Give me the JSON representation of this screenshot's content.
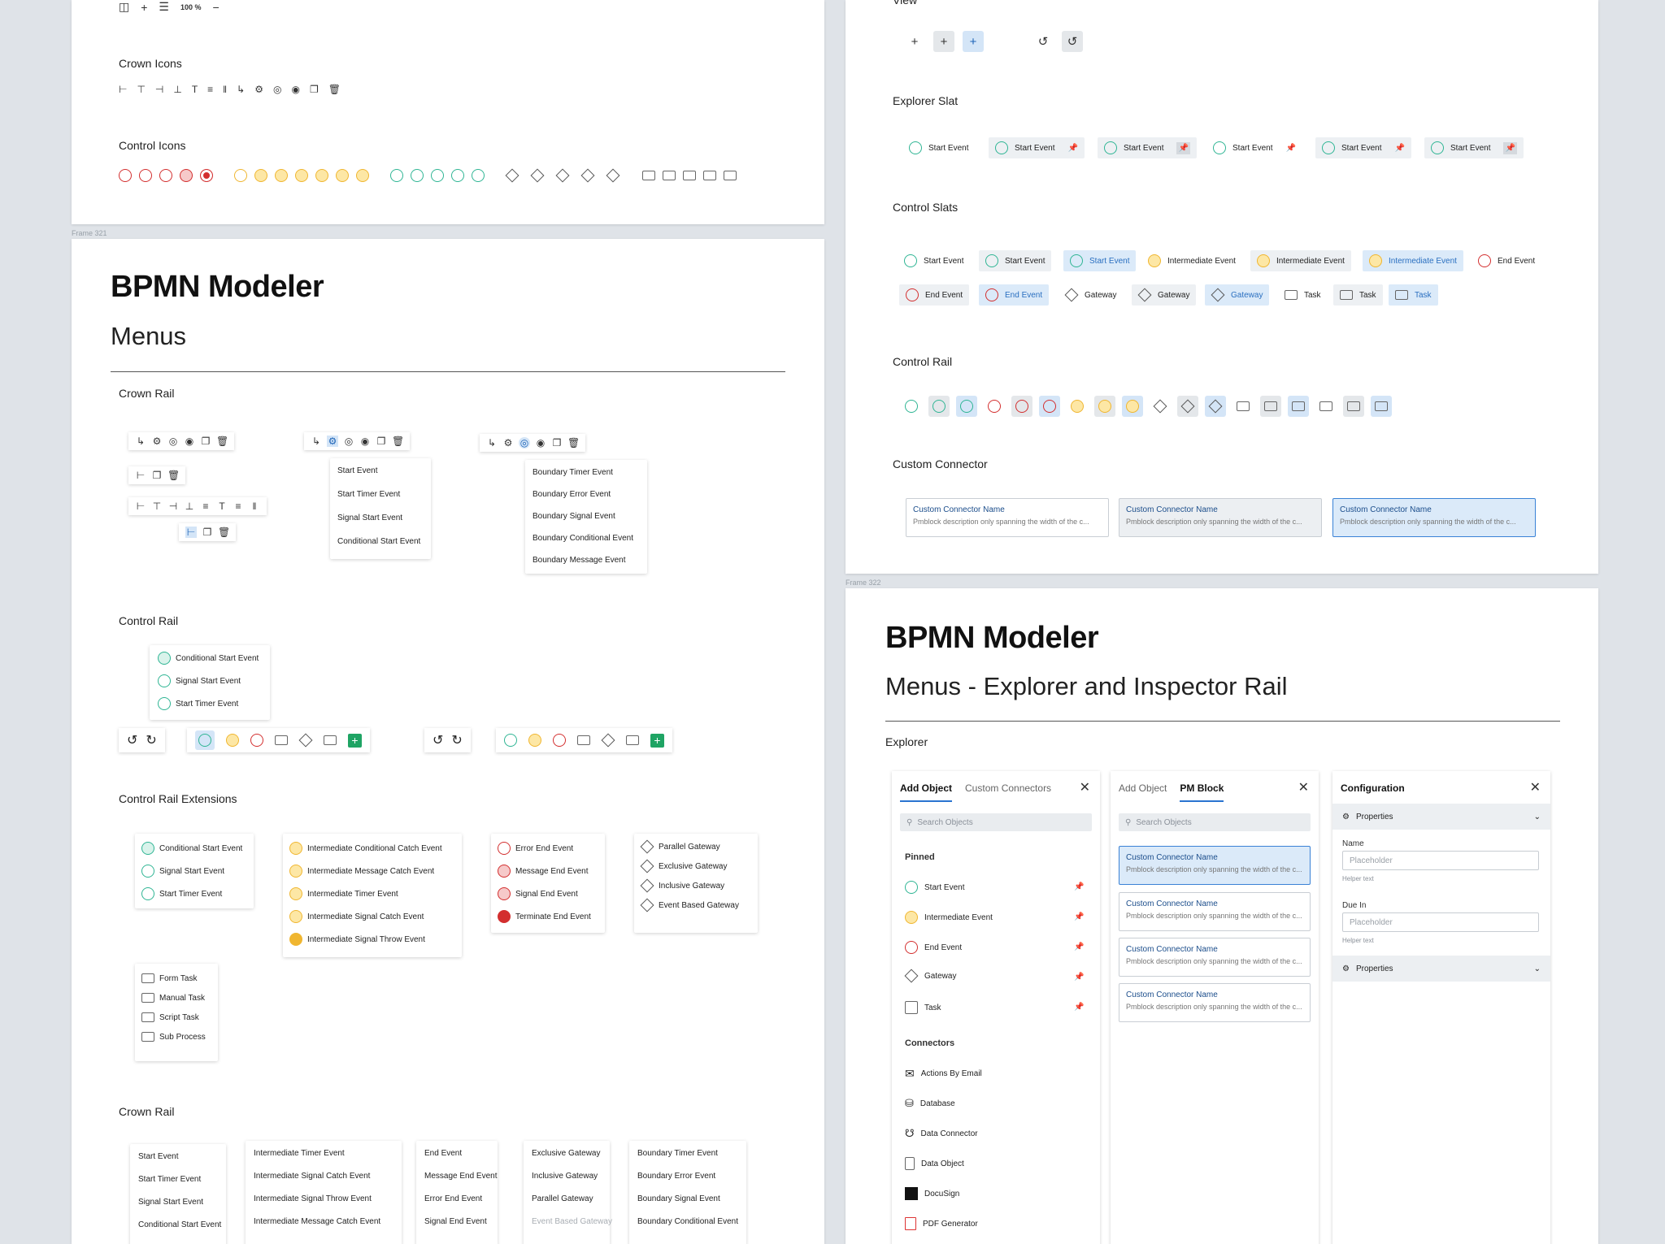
{
  "frames": {
    "frame321": "Frame 321",
    "frame322": "Frame 322"
  },
  "topleft": {
    "zoom": "100 %",
    "crown_icons_heading": "Crown Icons",
    "control_icons_heading": "Control Icons"
  },
  "menus": {
    "title": "BPMN Modeler",
    "subtitle": "Menus",
    "crown_rail_heading": "Crown Rail",
    "start_events": [
      "Start Event",
      "Start Timer Event",
      "Signal Start Event",
      "Conditional Start Event"
    ],
    "boundary_events": [
      "Boundary Timer Event",
      "Boundary Error Event",
      "Boundary Signal Event",
      "Boundary Conditional Event",
      "Boundary Message Event"
    ],
    "control_rail_heading": "Control Rail",
    "control_rail_popup": [
      "Conditional Start Event",
      "Signal Start Event",
      "Start Timer Event"
    ],
    "extensions_heading": "Control Rail Extensions",
    "ext_start": [
      "Conditional Start Event",
      "Signal Start Event",
      "Start Timer Event"
    ],
    "ext_intermediate": [
      "Intermediate Conditional Catch Event",
      "Intermediate Message Catch Event",
      "Intermediate Timer Event",
      "Intermediate Signal Catch Event",
      "Intermediate Signal Throw Event"
    ],
    "ext_end": [
      "Error End Event",
      "Message End Event",
      "Signal End Event",
      "Terminate End Event"
    ],
    "ext_gateway": [
      "Parallel Gateway",
      "Exclusive Gateway",
      "Inclusive Gateway",
      "Event Based Gateway"
    ],
    "ext_task": [
      "Form Task",
      "Manual Task",
      "Script Task",
      "Sub Process"
    ],
    "crown_rail2_heading": "Crown Rail",
    "cr_start": [
      "Start Event",
      "Start Timer Event",
      "Signal Start Event",
      "Conditional Start Event"
    ],
    "cr_intermediate": [
      "Intermediate Timer Event",
      "Intermediate Signal Catch Event",
      "Intermediate Signal Throw Event",
      "Intermediate Message Catch Event"
    ],
    "cr_end": [
      "End Event",
      "Message End Event",
      "Error End Event",
      "Signal End Event"
    ],
    "cr_gateway": [
      "Exclusive Gateway",
      "Inclusive Gateway",
      "Parallel Gateway",
      "Event Based Gateway"
    ],
    "cr_boundary": [
      "Boundary Timer Event",
      "Boundary Error Event",
      "Boundary Signal Event",
      "Boundary Conditional Event"
    ]
  },
  "right_top": {
    "view_heading": "View",
    "explorer_slat_heading": "Explorer Slat",
    "explorer_slats": [
      "Start Event",
      "Start Event",
      "Start Event",
      "Start Event",
      "Start Event",
      "Start Event"
    ],
    "control_slats_heading": "Control Slats",
    "control_slats_row1": [
      "Start Event",
      "Start Event",
      "Start Event",
      "Intermediate Event",
      "Intermediate Event",
      "Intermediate Event",
      "End Event"
    ],
    "control_slats_row2": [
      "End Event",
      "End Event",
      "Gateway",
      "Gateway",
      "Gateway",
      "Task",
      "Task",
      "Task"
    ],
    "control_rail_heading": "Control Rail",
    "custom_connector_heading": "Custom Connector",
    "connector_name": "Custom Connector Name",
    "connector_desc": "Pmblock description only spanning the width of the c..."
  },
  "explorer": {
    "title": "BPMN Modeler",
    "subtitle": "Menus - Explorer and Inspector Rail",
    "heading": "Explorer",
    "panel1": {
      "tab_active": "Add Object",
      "tab_other": "Custom Connectors",
      "search_placeholder": "Search Objects",
      "pinned_heading": "Pinned",
      "pinned": [
        "Start Event",
        "Intermediate Event",
        "End Event",
        "Gateway",
        "Task"
      ],
      "connectors_heading": "Connectors",
      "connectors": [
        "Actions By Email",
        "Database",
        "Data Connector",
        "Data Object",
        "DocuSign",
        "PDF Generator"
      ]
    },
    "panel2": {
      "tab_other": "Add Object",
      "tab_active": "PM Block",
      "search_placeholder": "Search Objects",
      "card_title": "Custom Connector Name",
      "card_desc": "Pmblock description only spanning the width of the c..."
    },
    "panel3": {
      "title": "Configuration",
      "properties": "Properties",
      "name_label": "Name",
      "name_placeholder": "Placeholder",
      "helper": "Helper text",
      "due_label": "Due In",
      "due_placeholder": "Placeholder",
      "helper2": "Helper text",
      "properties2": "Properties"
    }
  },
  "colors": {
    "teal": "#2fb594",
    "yellow": "#f0b630",
    "red": "#d32f2f",
    "accent": "#2a74d0",
    "background": "#dfe3e8"
  }
}
